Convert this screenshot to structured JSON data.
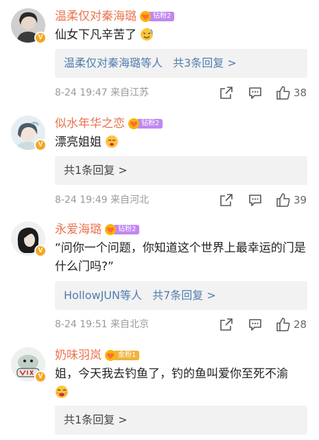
{
  "comments": [
    {
      "name": "温柔仅对秦海璐",
      "fan_tag": "钻粉2",
      "text": "仙女下凡辛苦了",
      "reply_users": "温柔仅对秦海璐等人",
      "reply_count": "共3条回复 >",
      "meta": "8-24 19:47  来自江苏",
      "likes": "38"
    },
    {
      "name": "似水年华之恋",
      "fan_tag": "钻粉2",
      "text": "漂亮姐姐",
      "reply_users": "",
      "reply_count": "共1条回复 >",
      "meta": "8-24 19:49  来自河北",
      "likes": "39"
    },
    {
      "name": "永爱海璐",
      "fan_tag": "钻粉2",
      "text": "“问你一个问题，你知道这个世界上最幸运的门是什么门吗?”",
      "reply_users": "HollowJUN等人",
      "reply_count": "共7条回复 >",
      "meta": "8-24 19:51  来自北京",
      "likes": "28"
    },
    {
      "name": "奶味羽岚",
      "fan_tag": "金粉1",
      "text": "姐，今天我去钓鱼了，钓的鱼叫爱你至死不渝",
      "reply_users": "",
      "reply_count": "共1条回复 >",
      "meta": "",
      "likes": ""
    }
  ],
  "colors": {
    "name": "#eb7350",
    "link": "#507daf",
    "meta": "#999999",
    "fan_purple": "#c187f0",
    "fan_gold": "#f0b43c"
  },
  "icons": [
    "verified-badge-icon",
    "fan-heart-icon",
    "share-icon",
    "comment-icon",
    "like-icon",
    "emoji-icon"
  ]
}
